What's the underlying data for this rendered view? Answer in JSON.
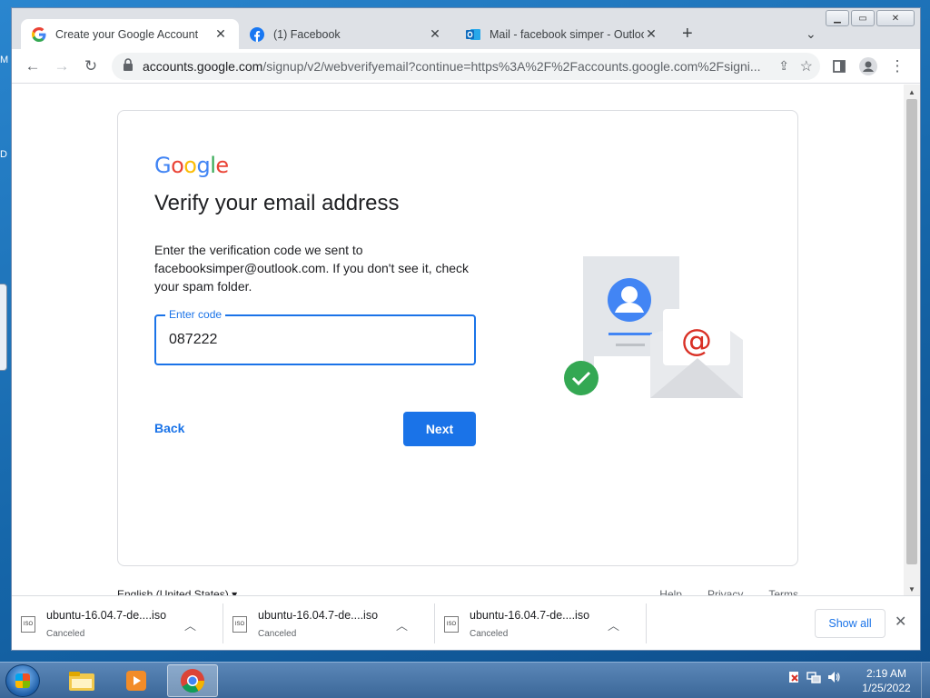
{
  "desktop": {
    "frag_m": "M",
    "frag_d": "D"
  },
  "tabs": [
    {
      "title": "Create your Google Account",
      "active": true,
      "icon": "google-icon"
    },
    {
      "title": "(1) Facebook",
      "active": false,
      "icon": "facebook-icon"
    },
    {
      "title": "Mail - facebook simper - Outlook",
      "active": false,
      "icon": "outlook-icon"
    }
  ],
  "toolbar": {
    "url_host": "accounts.google.com",
    "url_rest": "/signup/v2/webverifyemail?continue=https%3A%2F%2Faccounts.google.com%2Fsigni..."
  },
  "page": {
    "logo": [
      "G",
      "o",
      "o",
      "g",
      "l",
      "e"
    ],
    "logo_colors": [
      "#4285f4",
      "#ea4335",
      "#fbbc05",
      "#4285f4",
      "#34a853",
      "#ea4335"
    ],
    "heading": "Verify your email address",
    "description": "Enter the verification code we sent to facebooksimper@outlook.com. If you don't see it, check your spam folder.",
    "code_label": "Enter code",
    "code_value": "087222",
    "back_label": "Back",
    "next_label": "Next",
    "language": "English (United States)",
    "footer_links": [
      "Help",
      "Privacy",
      "Terms"
    ]
  },
  "downloads": [
    {
      "name": "ubuntu-16.04.7-de....iso",
      "status": "Canceled"
    },
    {
      "name": "ubuntu-16.04.7-de....iso",
      "status": "Canceled"
    },
    {
      "name": "ubuntu-16.04.7-de....iso",
      "status": "Canceled"
    }
  ],
  "downloads_show_all": "Show all",
  "file_icon_text": "ISO",
  "taskbar": {
    "time": "2:19 AM",
    "date": "1/25/2022"
  },
  "colors": {
    "accent": "#1a73e8",
    "check_green": "#34a853",
    "at_red": "#d93025"
  }
}
